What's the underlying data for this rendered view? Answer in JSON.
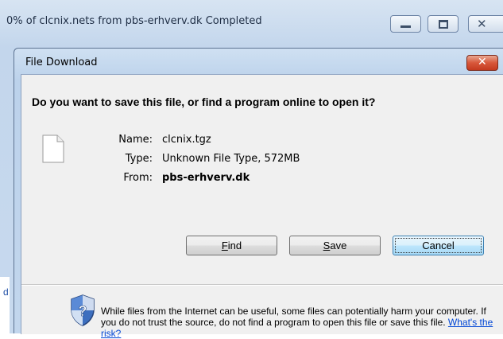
{
  "background_window": {
    "title": "0% of clcnix.nets from pbs-erhverv.dk Completed",
    "left_text": "d"
  },
  "dialog": {
    "title": "File Download",
    "question": "Do you want to save this file, or find a program online to open it?",
    "file": {
      "name_label": "Name:",
      "name_value": "clcnix.tgz",
      "type_label": "Type:",
      "type_value": "Unknown File Type, 572MB",
      "from_label": "From:",
      "from_value": "pbs-erhverv.dk"
    },
    "buttons": {
      "find": "Find",
      "save": "Save",
      "cancel": "Cancel"
    },
    "warning_text": "While files from the Internet can be useful, some files can potentially harm your computer. If you do not trust the source, do not find a program to open this file or save this file.",
    "risk_link": "What's the risk?"
  },
  "colors": {
    "accent": "#0046d5",
    "close_button": "#c43a1f"
  },
  "icons": [
    "minimize-icon",
    "maximize-icon",
    "close-icon",
    "file-icon",
    "shield-icon"
  ]
}
